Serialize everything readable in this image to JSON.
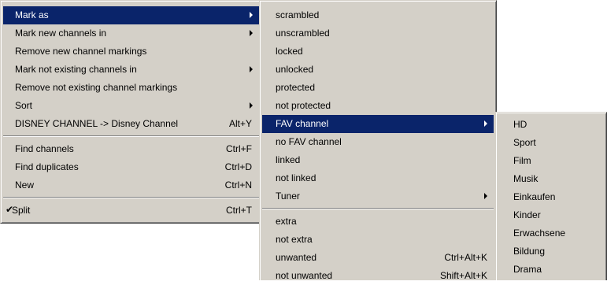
{
  "main_menu": {
    "items": [
      {
        "label": "Mark as",
        "shortcut": ""
      },
      {
        "label": "Mark new channels in",
        "shortcut": ""
      },
      {
        "label": "Remove new channel markings",
        "shortcut": ""
      },
      {
        "label": "Mark not existing channels in",
        "shortcut": ""
      },
      {
        "label": "Remove not existing channel markings",
        "shortcut": ""
      },
      {
        "label": "Sort",
        "shortcut": ""
      },
      {
        "label": "DISNEY CHANNEL -> Disney Channel",
        "shortcut": "Alt+Y"
      },
      {
        "label": "Find channels",
        "shortcut": "Ctrl+F"
      },
      {
        "label": "Find duplicates",
        "shortcut": "Ctrl+D"
      },
      {
        "label": "New",
        "shortcut": "Ctrl+N"
      },
      {
        "label": "Split",
        "shortcut": "Ctrl+T",
        "checked": true,
        "check_glyph": "✔"
      }
    ]
  },
  "mark_as_submenu": {
    "items": [
      {
        "label": "scrambled",
        "shortcut": ""
      },
      {
        "label": "unscrambled",
        "shortcut": ""
      },
      {
        "label": "locked",
        "shortcut": ""
      },
      {
        "label": "unlocked",
        "shortcut": ""
      },
      {
        "label": "protected",
        "shortcut": ""
      },
      {
        "label": "not protected",
        "shortcut": ""
      },
      {
        "label": "FAV channel",
        "shortcut": ""
      },
      {
        "label": "no FAV channel",
        "shortcut": ""
      },
      {
        "label": "linked",
        "shortcut": ""
      },
      {
        "label": "not linked",
        "shortcut": ""
      },
      {
        "label": "Tuner",
        "shortcut": ""
      },
      {
        "label": "extra",
        "shortcut": ""
      },
      {
        "label": "not extra",
        "shortcut": ""
      },
      {
        "label": "unwanted",
        "shortcut": "Ctrl+Alt+K"
      },
      {
        "label": "not unwanted",
        "shortcut": "Shift+Alt+K"
      }
    ]
  },
  "fav_submenu": {
    "items": [
      {
        "label": "HD"
      },
      {
        "label": "Sport"
      },
      {
        "label": "Film"
      },
      {
        "label": "Musik"
      },
      {
        "label": "Einkaufen"
      },
      {
        "label": "Kinder"
      },
      {
        "label": "Erwachsene"
      },
      {
        "label": "Bildung"
      },
      {
        "label": "Drama"
      }
    ]
  },
  "colors": {
    "menu_background": "#d4d0c8",
    "highlight_background": "#0a246a",
    "highlight_text": "#ffffff"
  },
  "icons": {
    "submenu_arrow": "triangle-right-icon",
    "checkmark": "check-icon"
  }
}
